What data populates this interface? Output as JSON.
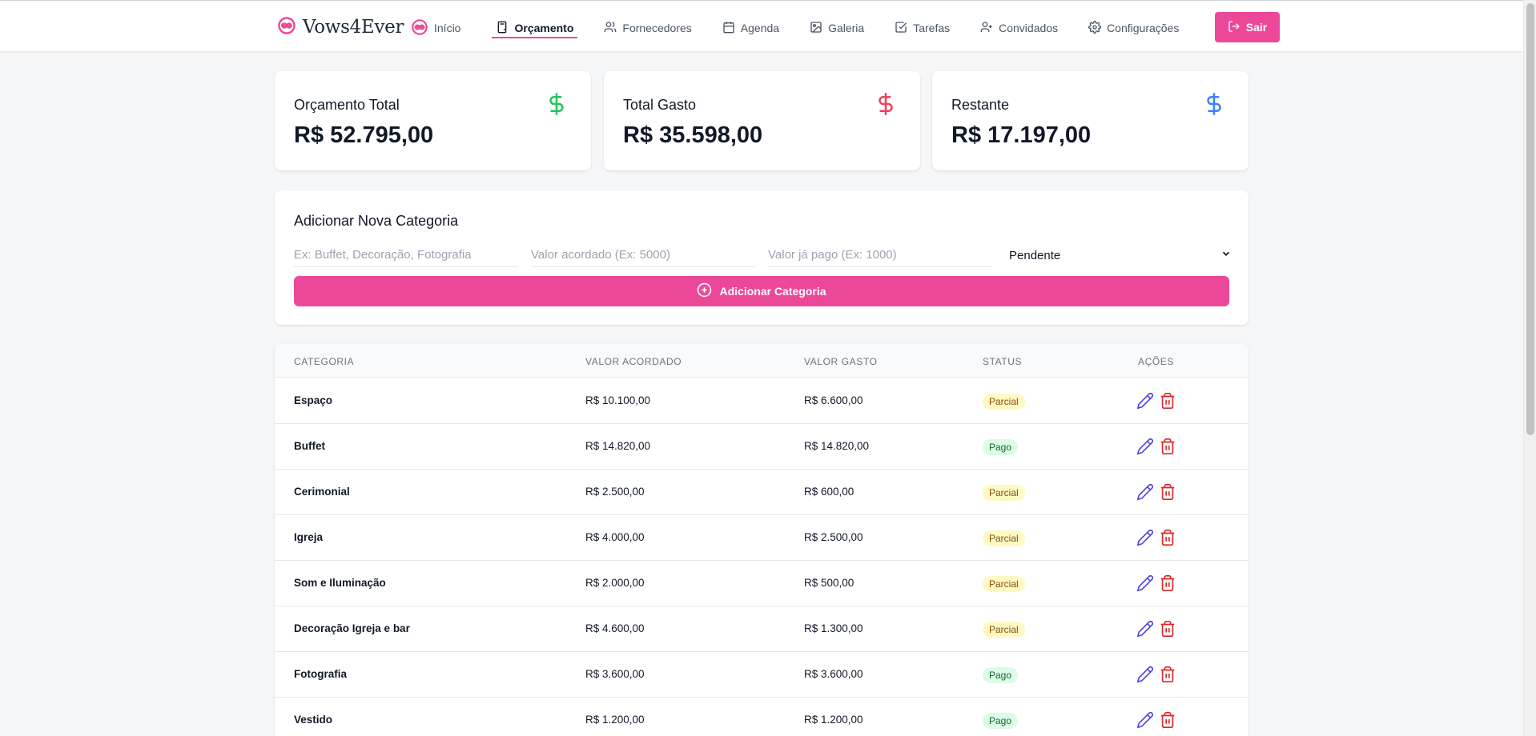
{
  "app": {
    "brand": "Vows4Ever"
  },
  "nav": {
    "items": [
      {
        "label": "Início",
        "icon": "heart-rings-icon",
        "active": false
      },
      {
        "label": "Orçamento",
        "icon": "calculator-icon",
        "active": true
      },
      {
        "label": "Fornecedores",
        "icon": "users-icon",
        "active": false
      },
      {
        "label": "Agenda",
        "icon": "calendar-icon",
        "active": false
      },
      {
        "label": "Galeria",
        "icon": "image-icon",
        "active": false
      },
      {
        "label": "Tarefas",
        "icon": "checkbox-icon",
        "active": false
      },
      {
        "label": "Convidados",
        "icon": "user-plus-icon",
        "active": false
      },
      {
        "label": "Configurações",
        "icon": "gear-icon",
        "active": false
      }
    ],
    "logout_label": "Sair"
  },
  "stats": [
    {
      "label": "Orçamento Total",
      "value": "R$ 52.795,00",
      "icon_color": "#22c55e"
    },
    {
      "label": "Total Gasto",
      "value": "R$ 35.598,00",
      "icon_color": "#f43f5e"
    },
    {
      "label": "Restante",
      "value": "R$ 17.197,00",
      "icon_color": "#3b82f6"
    }
  ],
  "add_category": {
    "title": "Adicionar Nova Categoria",
    "name_placeholder": "Ex: Buffet, Decoração, Fotografia",
    "agreed_placeholder": "Valor acordado (Ex: 5000)",
    "paid_placeholder": "Valor já pago (Ex: 1000)",
    "status_selected": "Pendente",
    "button_label": "Adicionar Categoria"
  },
  "table": {
    "headers": [
      "CATEGORIA",
      "VALOR ACORDADO",
      "VALOR GASTO",
      "STATUS",
      "AÇÕES"
    ],
    "rows": [
      {
        "category": "Espaço",
        "agreed": "R$ 10.100,00",
        "spent": "R$ 6.600,00",
        "status": "Parcial"
      },
      {
        "category": "Buffet",
        "agreed": "R$ 14.820,00",
        "spent": "R$ 14.820,00",
        "status": "Pago"
      },
      {
        "category": "Cerimonial",
        "agreed": "R$ 2.500,00",
        "spent": "R$ 600,00",
        "status": "Parcial"
      },
      {
        "category": "Igreja",
        "agreed": "R$ 4.000,00",
        "spent": "R$ 2.500,00",
        "status": "Parcial"
      },
      {
        "category": "Som e Iluminação",
        "agreed": "R$ 2.000,00",
        "spent": "R$ 500,00",
        "status": "Parcial"
      },
      {
        "category": "Decoração Igreja e bar",
        "agreed": "R$ 4.600,00",
        "spent": "R$ 1.300,00",
        "status": "Parcial"
      },
      {
        "category": "Fotografia",
        "agreed": "R$ 3.600,00",
        "spent": "R$ 3.600,00",
        "status": "Pago"
      },
      {
        "category": "Vestido",
        "agreed": "R$ 1.200,00",
        "spent": "R$ 1.200,00",
        "status": "Pago"
      }
    ]
  },
  "colors": {
    "accent": "#ec4899",
    "edit_icon": "#4f46e5",
    "delete_icon": "#dc2626"
  }
}
